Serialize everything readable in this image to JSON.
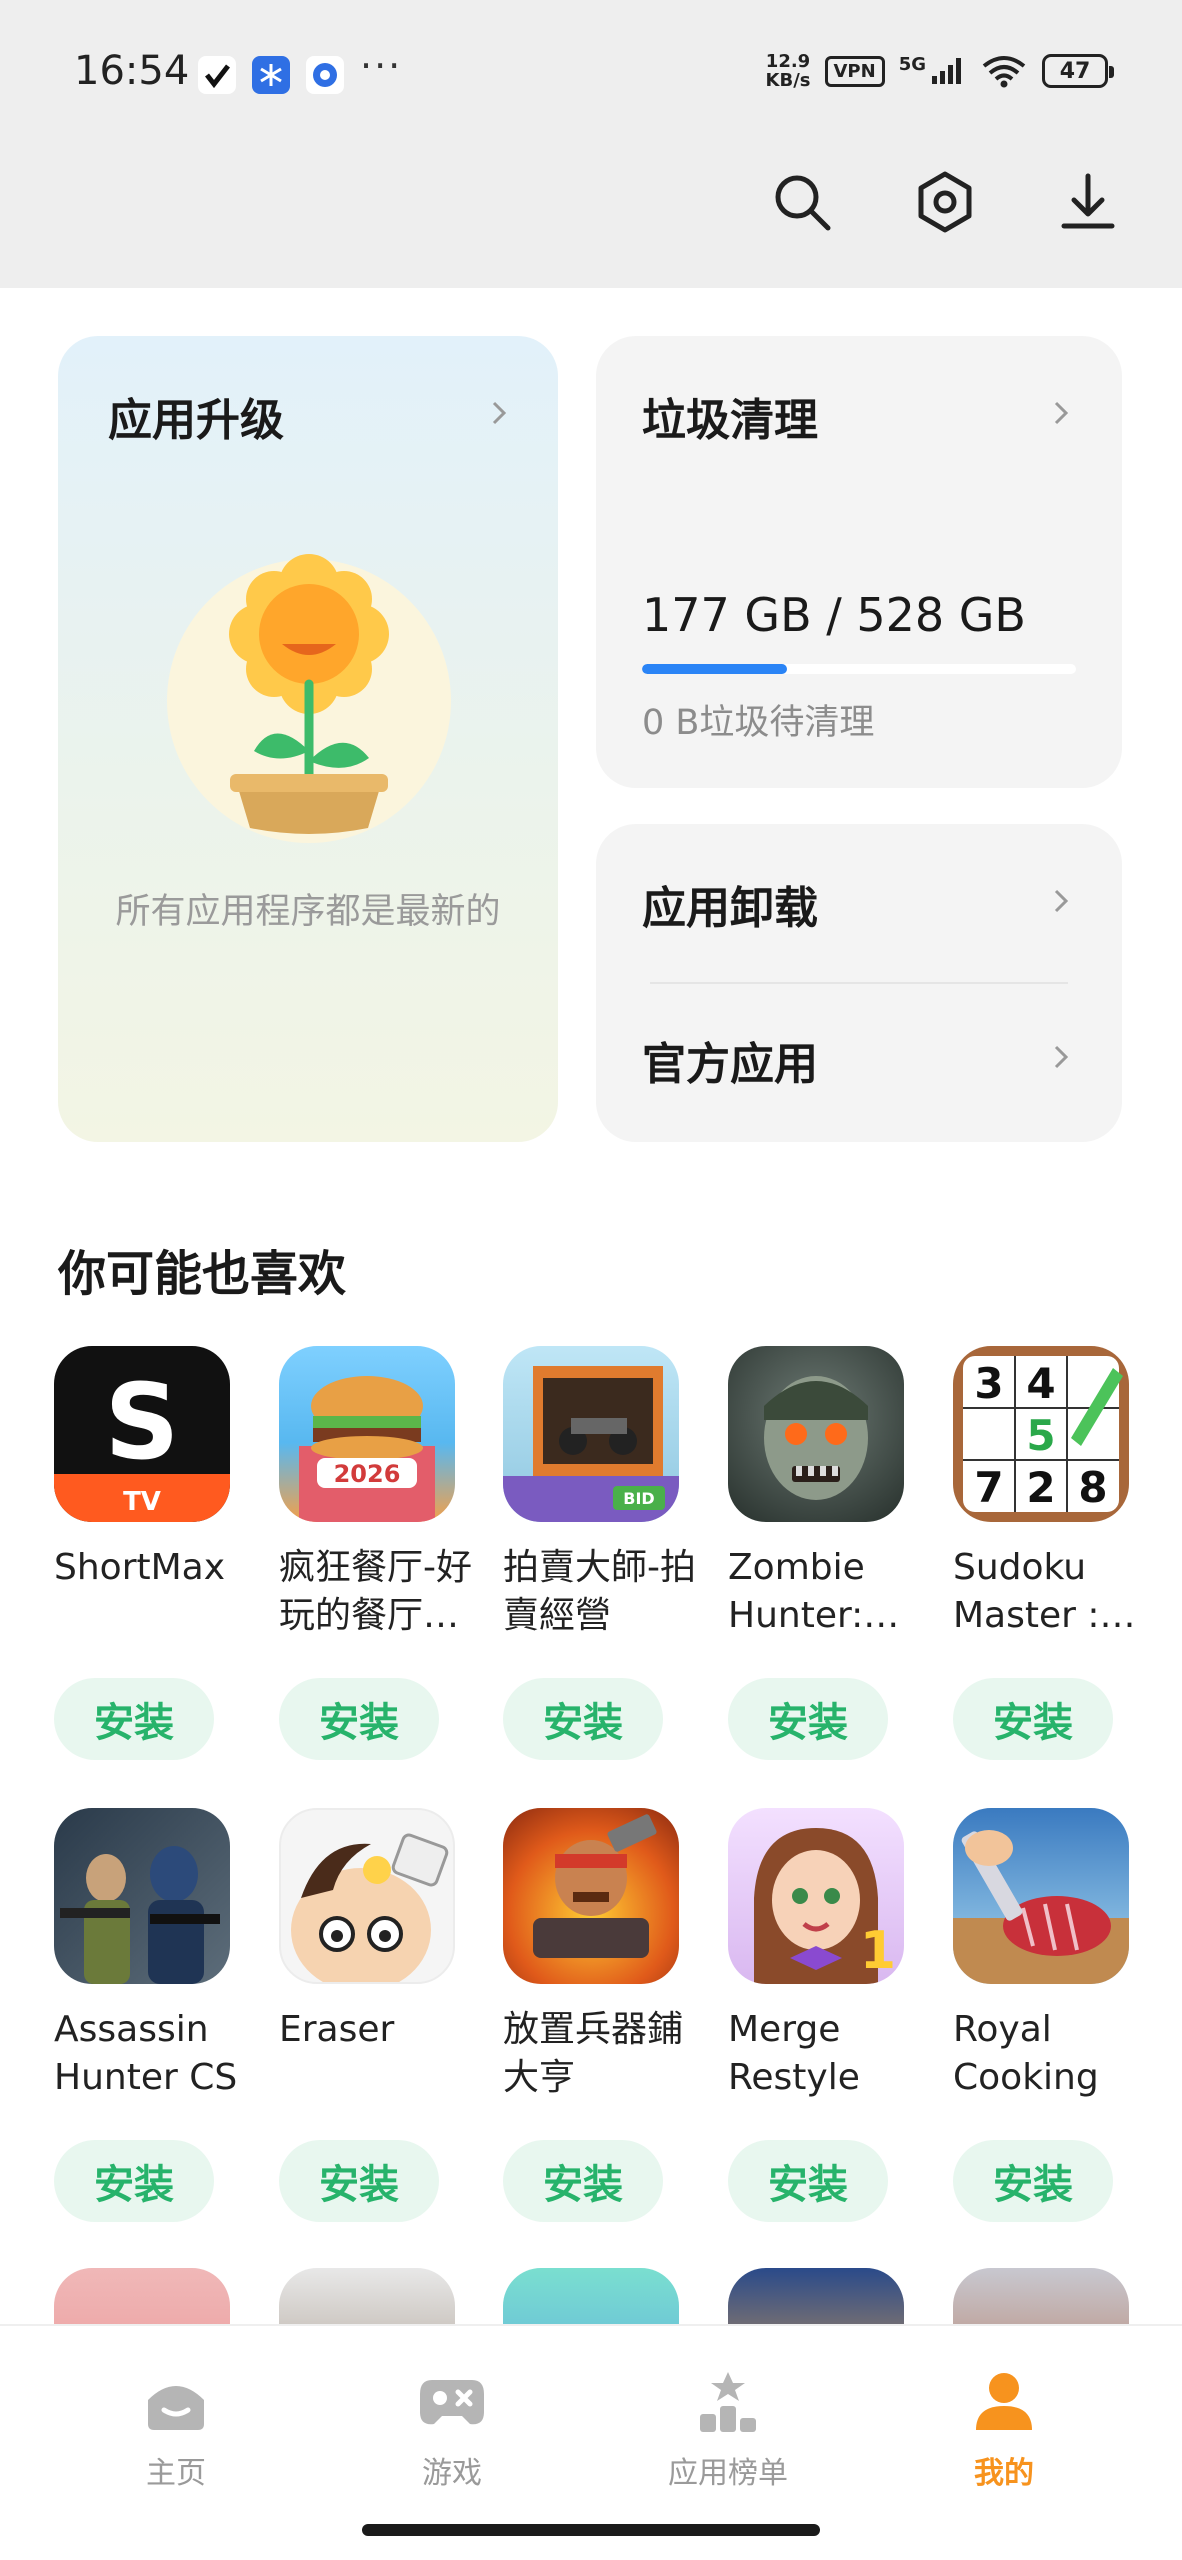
{
  "status_bar": {
    "time": "16:54",
    "net_speed_value": "12.9",
    "net_speed_unit": "KB/s",
    "vpn_label": "VPN",
    "network_label": "5G",
    "battery": "47"
  },
  "header": {
    "icons": [
      "search-icon",
      "settings-icon",
      "download-icon"
    ]
  },
  "cards": {
    "upgrade": {
      "title": "应用升级",
      "message": "所有应用程序都是最新的"
    },
    "cleanup": {
      "title": "垃圾清理",
      "storage": "177 GB / 528 GB",
      "storage_used_fraction": 0.335,
      "junk": "0 B垃圾待清理"
    },
    "uninstall": {
      "title": "应用卸载"
    },
    "official": {
      "title": "官方应用"
    }
  },
  "recommend": {
    "title": "你可能也喜欢",
    "install_label": "安装",
    "apps": [
      {
        "name": "ShortMax"
      },
      {
        "name": "疯狂餐厅-好玩的餐厅游戏"
      },
      {
        "name": "拍賣大師-拍賣經營"
      },
      {
        "name": "Zombie Hunter: Survival"
      },
      {
        "name": "Sudoku Master : Classic"
      },
      {
        "name": "Assassin Hunter CS"
      },
      {
        "name": "Eraser"
      },
      {
        "name": "放置兵器鋪大亨"
      },
      {
        "name": "Merge Restyle"
      },
      {
        "name": "Royal Cooking"
      }
    ]
  },
  "bottom_nav": {
    "items": [
      {
        "label": "主页",
        "icon": "home-icon"
      },
      {
        "label": "游戏",
        "icon": "gamepad-icon"
      },
      {
        "label": "应用榜单",
        "icon": "ranking-icon"
      },
      {
        "label": "我的",
        "icon": "profile-icon",
        "active": true
      }
    ],
    "accent": "#f7931e"
  },
  "colors": {
    "install_text": "#27b36b",
    "install_bg": "#e8f7ef",
    "storage_bar": "#2a84f6"
  }
}
